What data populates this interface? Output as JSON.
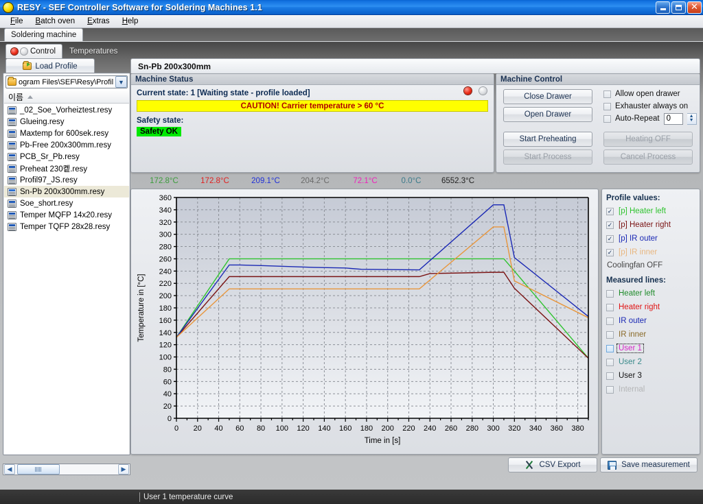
{
  "window": {
    "title": "RESY - SEF Controller Software for Soldering Machines 1.1",
    "app_icon": "sun-icon",
    "minimize_label": "–",
    "maximize_label": "□",
    "close_label": "✕"
  },
  "menu": {
    "items": [
      {
        "label": "File"
      },
      {
        "label": "Batch oven"
      },
      {
        "label": "Extras"
      },
      {
        "label": "Help"
      }
    ]
  },
  "outer_tab": {
    "label": "Soldering machine"
  },
  "inner_tabs": {
    "control": {
      "label": "Control"
    },
    "temperatures": {
      "label": "Temperatures"
    }
  },
  "left_panel": {
    "load_profile_label": "Load Profile",
    "path": "ogram Files\\SEF\\Resy\\Profiles",
    "combo_arrow": "▼",
    "list_header": "이름",
    "files": [
      {
        "name": "_02_Soe_Vorheiztest.resy",
        "selected": false
      },
      {
        "name": "Glueing.resy",
        "selected": false
      },
      {
        "name": "Maxtemp for 600sek.resy",
        "selected": false
      },
      {
        "name": "Pb-Free 200x300mm.resy",
        "selected": false
      },
      {
        "name": "PCB_Sr_Pb.resy",
        "selected": false
      },
      {
        "name": "Preheat 230콑.resy",
        "selected": false
      },
      {
        "name": "Profil97_JS.resy",
        "selected": false
      },
      {
        "name": "Sn-Pb 200x300mm.resy",
        "selected": true
      },
      {
        "name": "Soe_short.resy",
        "selected": false
      },
      {
        "name": "Temper MQFP 14x20.resy",
        "selected": false
      },
      {
        "name": "Temper TQFP 28x28.resy",
        "selected": false
      }
    ],
    "scroll_left": "◀",
    "scroll_right": "▶"
  },
  "profile_title": "Sn-Pb 200x300mm",
  "machine_status": {
    "header": "Machine Status",
    "current_state": "Current state: 1 [Waiting state - profile loaded]",
    "caution": "CAUTION! Carrier temperature > 60 °C",
    "safety_label": "Safety state:",
    "safety_value": "Safety OK",
    "led_red": "status-led-red",
    "led_off": "status-led-off"
  },
  "machine_control": {
    "header": "Machine Control",
    "close_drawer": "Close Drawer",
    "open_drawer": "Open Drawer",
    "start_preheating": "Start Preheating",
    "start_process": "Start Process",
    "heating_off": "Heating OFF",
    "cancel_process": "Cancel Process",
    "allow_open_drawer": "Allow open drawer",
    "exhauster_always_on": "Exhauster always on",
    "auto_repeat": "Auto-Repeat",
    "auto_repeat_value": "0",
    "spin_up": "▲",
    "spin_down": "▼"
  },
  "temperature_readouts": [
    {
      "value": "172.8°C",
      "color": "#3c9c3c"
    },
    {
      "value": "172.8°C",
      "color": "#e02020"
    },
    {
      "value": "209.1°C",
      "color": "#2030d8"
    },
    {
      "value": "204.2°C",
      "color": "#6a6a6a"
    },
    {
      "value": "72.1°C",
      "color": "#ee22bb"
    },
    {
      "value": "0.0°C",
      "color": "#3a7a8a"
    },
    {
      "value": "6552.3°C",
      "color": "#222222"
    }
  ],
  "legend": {
    "profile_title": "Profile values:",
    "profile_items": [
      {
        "label": "[p] Heater left",
        "color": "#2fc32f",
        "checked": true,
        "dim": false
      },
      {
        "label": "[p] Heater right",
        "color": "#7a1414",
        "checked": true,
        "dim": false
      },
      {
        "label": "[p] IR outer",
        "color": "#1a28b4",
        "checked": true,
        "dim": false
      },
      {
        "label": "[p] IR inner",
        "color": "#e8963c",
        "checked": true,
        "dim": true
      }
    ],
    "coolingfan": "Coolingfan OFF",
    "measured_title": "Measured lines:",
    "measured_items": [
      {
        "label": "Heater left",
        "color": "#1f8b2a",
        "checked": false,
        "focus": false,
        "dim": false
      },
      {
        "label": "Heater right",
        "color": "#e01414",
        "checked": false,
        "focus": false,
        "dim": false
      },
      {
        "label": "IR outer",
        "color": "#1a28b4",
        "checked": false,
        "focus": false,
        "dim": false
      },
      {
        "label": "IR inner",
        "color": "#8a6a28",
        "checked": false,
        "focus": false,
        "dim": false
      },
      {
        "label": "User 1",
        "color": "#d628c8",
        "checked": false,
        "focus": true,
        "dim": false
      },
      {
        "label": "User 2",
        "color": "#3a8a8a",
        "checked": false,
        "focus": false,
        "dim": false
      },
      {
        "label": "User 3",
        "color": "#111111",
        "checked": false,
        "focus": false,
        "dim": false
      },
      {
        "label": "Internal",
        "color": "#9a9a9a",
        "checked": false,
        "focus": false,
        "dim": true
      }
    ],
    "check_glyph": "✓"
  },
  "bottom": {
    "csv_export": "CSV Export",
    "save_measurement": "Save measurement"
  },
  "statusbar": {
    "text": "User 1 temperature curve"
  },
  "chart_data": {
    "type": "line",
    "title": "",
    "xlabel": "Time in [s]",
    "ylabel": "Temperature in [°C]",
    "xlim": [
      0,
      390
    ],
    "ylim": [
      0,
      360
    ],
    "xticks": [
      0,
      20,
      40,
      60,
      80,
      100,
      120,
      140,
      160,
      180,
      200,
      220,
      240,
      260,
      280,
      300,
      320,
      340,
      360,
      380
    ],
    "yticks": [
      0,
      20,
      40,
      60,
      80,
      100,
      120,
      140,
      160,
      180,
      200,
      220,
      240,
      260,
      280,
      300,
      320,
      340,
      360
    ],
    "grid": true,
    "legend_position": "right-panel",
    "series": [
      {
        "name": "[p] Heater left",
        "color": "#2fc32f",
        "points": [
          [
            0,
            132
          ],
          [
            50,
            260
          ],
          [
            310,
            260
          ],
          [
            320,
            240
          ],
          [
            390,
            98
          ]
        ]
      },
      {
        "name": "[p] Heater right",
        "color": "#7a1414",
        "points": [
          [
            0,
            132
          ],
          [
            50,
            231
          ],
          [
            230,
            231
          ],
          [
            240,
            236
          ],
          [
            300,
            238
          ],
          [
            310,
            238
          ],
          [
            320,
            212
          ],
          [
            390,
            98
          ]
        ]
      },
      {
        "name": "[p] IR outer",
        "color": "#1a28b4",
        "points": [
          [
            0,
            132
          ],
          [
            50,
            250
          ],
          [
            60,
            250
          ],
          [
            80,
            249
          ],
          [
            130,
            246
          ],
          [
            160,
            245
          ],
          [
            175,
            243
          ],
          [
            230,
            242
          ],
          [
            300,
            348
          ],
          [
            310,
            348
          ],
          [
            320,
            262
          ],
          [
            390,
            166
          ]
        ]
      },
      {
        "name": "[p] IR inner",
        "color": "#e8963c",
        "points": [
          [
            0,
            132
          ],
          [
            50,
            211
          ],
          [
            230,
            211
          ],
          [
            300,
            312
          ],
          [
            310,
            312
          ],
          [
            320,
            224
          ],
          [
            390,
            164
          ]
        ]
      }
    ]
  }
}
